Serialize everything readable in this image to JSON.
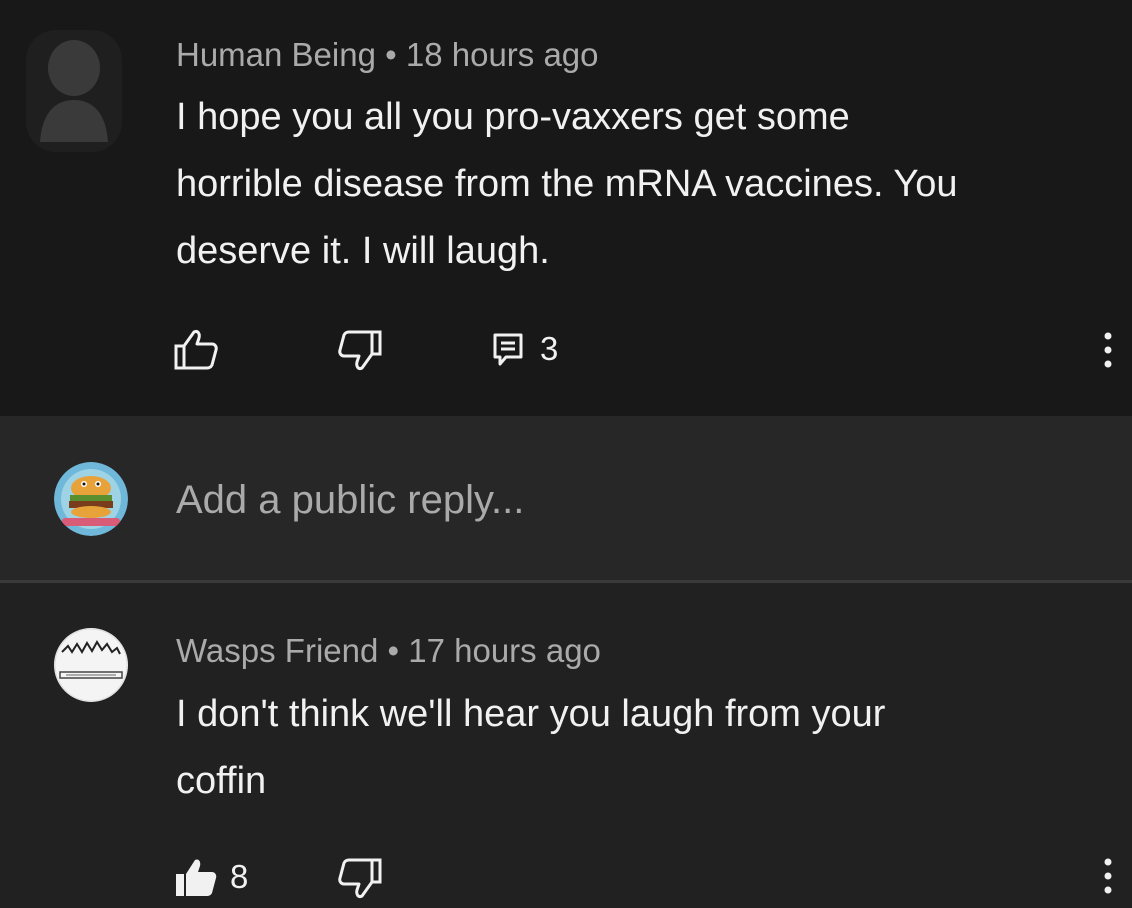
{
  "comment": {
    "author": "Human Being",
    "separator": "•",
    "time": "18 hours ago",
    "lines": [
      "I hope you all you pro-vaxxers get some",
      "horrible disease from the mRNA vaccines. You",
      "deserve it. I will laugh."
    ],
    "reply_count": "3",
    "icons": [
      "like-icon",
      "dislike-icon",
      "reply-icon",
      "more-vert-icon"
    ]
  },
  "reply_box": {
    "placeholder": "Add a public reply..."
  },
  "reply": {
    "author": "Wasps Friend",
    "separator": "•",
    "time": "17 hours ago",
    "lines": [
      "I don't think we'll hear you laugh from your",
      "coffin"
    ],
    "like_count": "8",
    "icons": [
      "like-filled-icon",
      "dislike-icon",
      "more-vert-icon"
    ]
  },
  "colors": {
    "top_background": "#181818",
    "page_background": "#212121",
    "reply_bar_background": "#272727",
    "secondary_text": "#aaaaaa",
    "primary_text": "#f1f1f1"
  }
}
